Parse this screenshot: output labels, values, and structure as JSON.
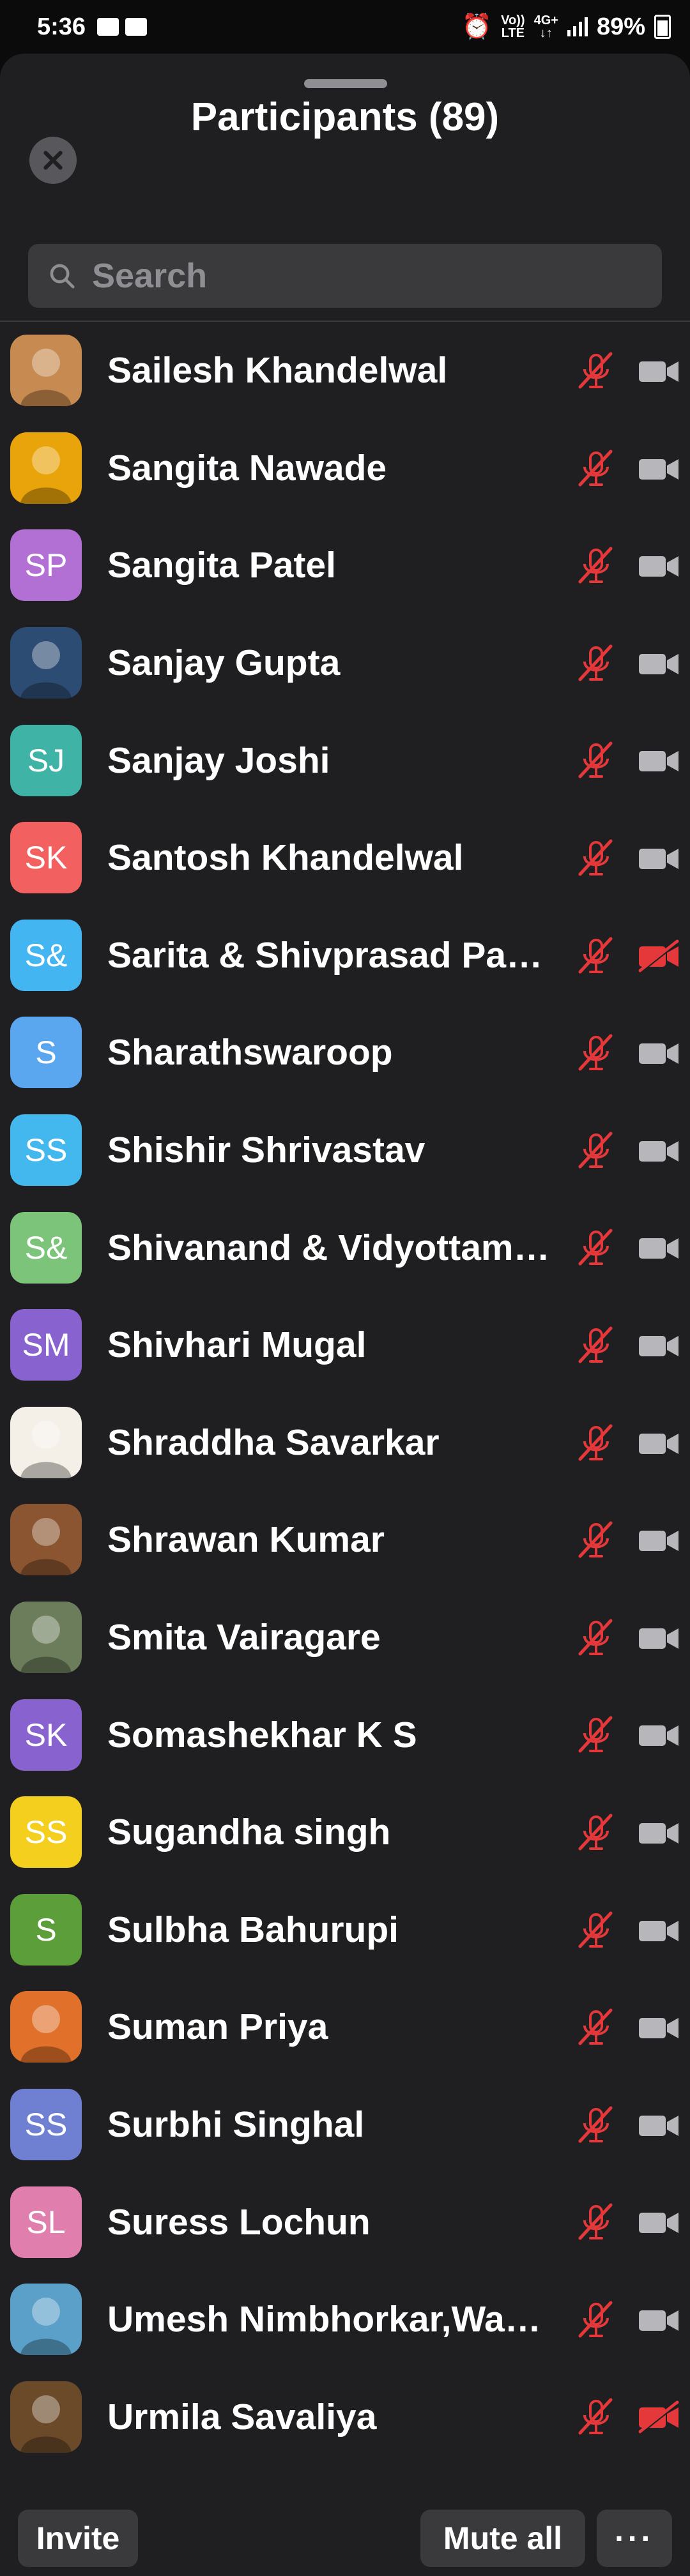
{
  "status_bar": {
    "time": "5:36",
    "network_top": "Vo))",
    "network_bottom": "LTE",
    "net_type_top": "4G+",
    "net_type_bottom": "↓↑",
    "battery": "89%"
  },
  "header": {
    "title": "Participants (89)"
  },
  "search": {
    "placeholder": "Search",
    "value": ""
  },
  "colors": {
    "muted_red": "#e5383b",
    "cam_gray": "#b7b7bb",
    "sheet_bg": "#1f1f21"
  },
  "participants": [
    {
      "name": "Sailesh Khandelwal",
      "initials": "",
      "avatar_color": "#c78a50",
      "cam_off": false
    },
    {
      "name": "Sangita Nawade",
      "initials": "",
      "avatar_color": "#e8a40a",
      "cam_off": false
    },
    {
      "name": "Sangita Patel",
      "initials": "SP",
      "avatar_color": "#b26fd4",
      "cam_off": false
    },
    {
      "name": "Sanjay Gupta",
      "initials": "",
      "avatar_color": "#2d4c73",
      "cam_off": false
    },
    {
      "name": "Sanjay Joshi",
      "initials": "SJ",
      "avatar_color": "#3fb3a6",
      "cam_off": false
    },
    {
      "name": "Santosh Khandelwal",
      "initials": "SK",
      "avatar_color": "#f26060",
      "cam_off": false
    },
    {
      "name": "Sarita & Shivprasad Pat…",
      "initials": "S&",
      "avatar_color": "#43b6f2",
      "cam_off": true
    },
    {
      "name": "Sharathswaroop",
      "initials": "S",
      "avatar_color": "#5aa7ef",
      "cam_off": false
    },
    {
      "name": "Shishir Shrivastav",
      "initials": "SS",
      "avatar_color": "#43b8ee",
      "cam_off": false
    },
    {
      "name": "Shivanand & Vidyottam…",
      "initials": "S&",
      "avatar_color": "#7cc47a",
      "cam_off": false
    },
    {
      "name": "Shivhari Mugal",
      "initials": "SM",
      "avatar_color": "#8863cf",
      "cam_off": false
    },
    {
      "name": "Shraddha Savarkar",
      "initials": "",
      "avatar_color": "#f4f0e8",
      "cam_off": false
    },
    {
      "name": "Shrawan Kumar",
      "initials": "",
      "avatar_color": "#8a5530",
      "cam_off": false
    },
    {
      "name": "Smita Vairagare",
      "initials": "",
      "avatar_color": "#6b7d5a",
      "cam_off": false
    },
    {
      "name": "Somashekhar K S",
      "initials": "SK",
      "avatar_color": "#8863cf",
      "cam_off": false
    },
    {
      "name": "Sugandha singh",
      "initials": "SS",
      "avatar_color": "#f4cf1d",
      "cam_off": false
    },
    {
      "name": "Sulbha Bahurupi",
      "initials": "S",
      "avatar_color": "#5c9e3a",
      "cam_off": false
    },
    {
      "name": "Suman Priya",
      "initials": "",
      "avatar_color": "#e0702a",
      "cam_off": false
    },
    {
      "name": "Surbhi Singhal",
      "initials": "SS",
      "avatar_color": "#6f7fd1",
      "cam_off": false
    },
    {
      "name": "Suress Lochun",
      "initials": "SL",
      "avatar_color": "#e07fae",
      "cam_off": false
    },
    {
      "name": "Umesh Nimbhorkar,War…",
      "initials": "",
      "avatar_color": "#5aa0c8",
      "cam_off": false
    },
    {
      "name": "Urmila Savaliya",
      "initials": "",
      "avatar_color": "#6b4a2a",
      "cam_off": true
    }
  ],
  "footer": {
    "invite_label": "Invite",
    "mute_all_label": "Mute all",
    "more_label": "···"
  }
}
